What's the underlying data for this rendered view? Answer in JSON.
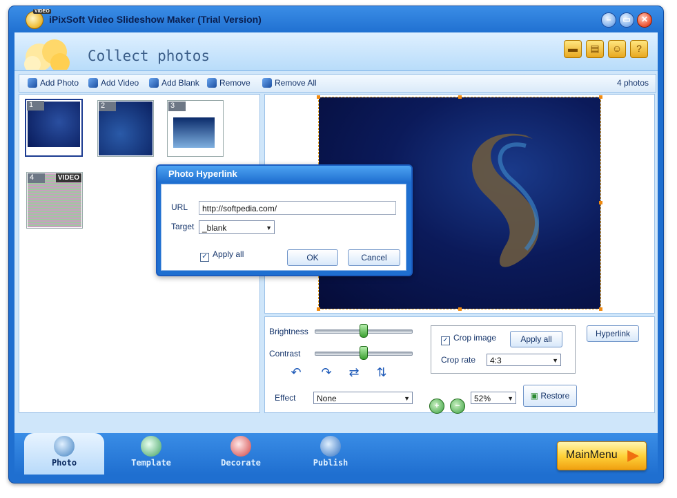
{
  "window": {
    "title": "iPixSoft Video Slideshow Maker (Trial Version)",
    "app_icon_badge": "VIDEO"
  },
  "header": {
    "page_title": "Collect photos"
  },
  "toolbar": {
    "add_photo": "Add Photo",
    "add_video": "Add Video",
    "add_blank": "Add Blank",
    "remove": "Remove",
    "remove_all": "Remove All",
    "photo_count": "4 photos"
  },
  "thumbnails": [
    {
      "num": "1"
    },
    {
      "num": "2"
    },
    {
      "num": "3"
    },
    {
      "num": "4",
      "badge": "VIDEO"
    }
  ],
  "controls": {
    "brightness_label": "Brightness",
    "brightness_level": 0.5,
    "contrast_label": "Contrast",
    "contrast_level": 0.5,
    "effect_label": "Effect",
    "effect_value": "None",
    "crop_image_label": "Crop image",
    "crop_image_checked": true,
    "apply_all_label": "Apply all",
    "crop_rate_label": "Crop rate",
    "crop_rate_value": "4:3",
    "hyperlink_label": "Hyperlink",
    "zoom_value": "52%",
    "restore_label": "Restore"
  },
  "dialog": {
    "title": "Photo Hyperlink",
    "url_label": "URL",
    "url_value": "http://softpedia.com/",
    "target_label": "Target",
    "target_value": "_blank",
    "apply_all_label": "Apply all",
    "apply_all_checked": true,
    "ok_label": "OK",
    "cancel_label": "Cancel"
  },
  "bottom_nav": {
    "tabs": [
      {
        "label": "Photo",
        "active": true
      },
      {
        "label": "Template",
        "active": false
      },
      {
        "label": "Decorate",
        "active": false
      },
      {
        "label": "Publish",
        "active": false
      }
    ],
    "main_menu_label": "MainMenu"
  },
  "colors": {
    "accent": "#1f6fd0",
    "panel": "#cfe6fa",
    "main_menu": "#ffd23a"
  }
}
